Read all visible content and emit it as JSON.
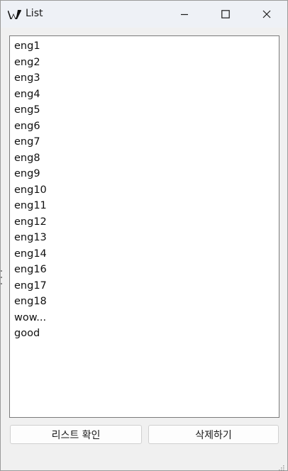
{
  "window": {
    "title": "List",
    "app_icon": "w-logo-icon",
    "controls": {
      "minimize_icon": "minimize-icon",
      "maximize_icon": "maximize-icon",
      "close_icon": "close-icon"
    }
  },
  "list": {
    "items": [
      "eng1",
      "eng2",
      "eng3",
      "eng4",
      "eng5",
      "eng6",
      "eng7",
      "eng8",
      "eng9",
      "eng10",
      "eng11",
      "eng12",
      "eng13",
      "eng14",
      "eng16",
      "eng17",
      "eng18",
      "wow...",
      "good"
    ]
  },
  "buttons": {
    "check_list_label": "리스트 확인",
    "delete_label": "삭제하기"
  },
  "colors": {
    "window_bg": "#f0f0f0",
    "titlebar_bg": "#eef1f6",
    "list_bg": "#ffffff",
    "list_border": "#7a7a7a"
  }
}
